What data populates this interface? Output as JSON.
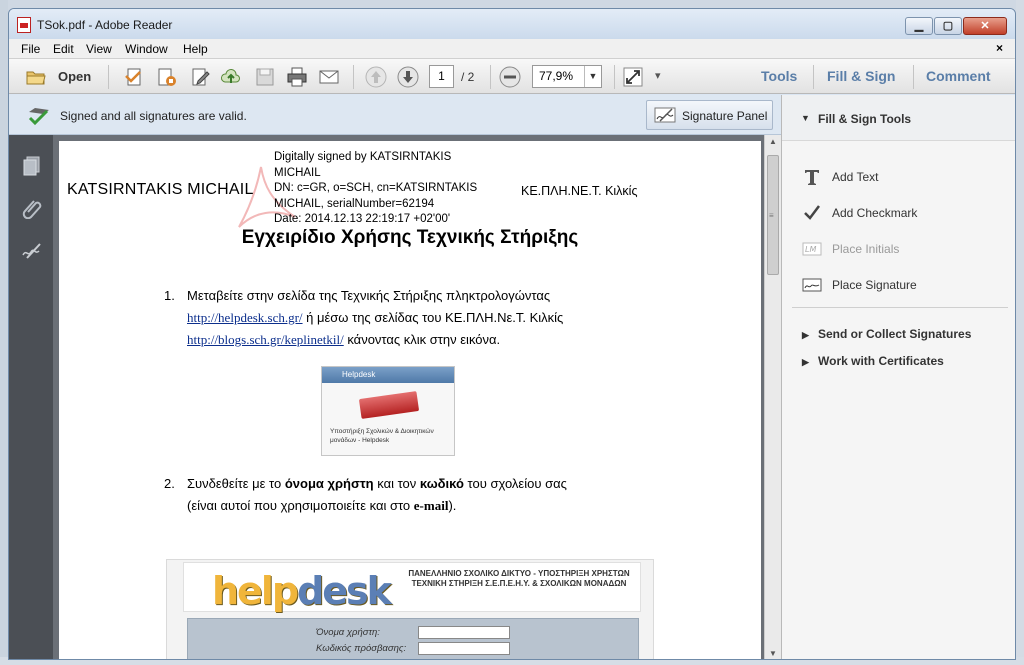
{
  "window": {
    "title": "TSok.pdf - Adobe Reader",
    "controls": {
      "minimize": "▁",
      "maximize": "▢",
      "close": "✕"
    }
  },
  "menu": {
    "items": [
      "File",
      "Edit",
      "View",
      "Window",
      "Help"
    ],
    "close_doc": "×"
  },
  "toolbar": {
    "open_label": "Open",
    "page_current": "1",
    "page_total": "/ 2",
    "zoom": "77,9%",
    "zoom_dd": "▼",
    "more": "▾",
    "tabs": [
      "Tools",
      "Fill & Sign",
      "Comment"
    ]
  },
  "signature_bar": {
    "status_text": "Signed and all signatures are valid.",
    "panel_button": "Signature Panel"
  },
  "document": {
    "author_name": "KATSIRNTAKIS MICHAIL",
    "signature_block": [
      "Digitally signed by KATSIRNTAKIS",
      "MICHAIL",
      "DN: c=GR, o=SCH, cn=KATSIRNTAKIS",
      "MICHAIL, serialNumber=62194",
      "Date: 2014.12.13 22:19:17 +02'00'"
    ],
    "organization": "ΚΕ.ΠΛΗ.ΝΕ.Τ. Κιλκίς",
    "title": "Εγχειρίδιο Χρήσης Τεχνικής Στήριξης",
    "item1": {
      "number": "1.",
      "line1": "Μεταβείτε στην σελίδα της Τεχνικής Στήριξης πληκτρολογώντας",
      "link1": "http://helpdesk.sch.gr/",
      "line2": " ή μέσω της σελίδας του ΚΕ.ΠΛΗ.Νε.Τ. Κιλκίς",
      "link2": "http://blogs.sch.gr/keplinetkil/",
      "line3": " κάνοντας κλικ στην εικόνα."
    },
    "thumb": {
      "header": "Helpdesk",
      "caption": "Υποστήριξη Σχολικών & Διοικητικών μονάδων - Helpdesk"
    },
    "item2": {
      "number": "2.",
      "pre": "Συνδεθείτε με το ",
      "bold1": "όνομα χρήστη",
      "mid": " και τον ",
      "bold2": "κωδικό",
      "post": " του σχολείου σας",
      "line2_pre": "(είναι αυτοί που χρησιμοποιείτε και στο ",
      "line2_bold": "e-mail",
      "line2_post": ")."
    },
    "screenshot": {
      "logo_a": "help",
      "logo_b": "desk",
      "head_line1": "ΠΑΝΕΛΛΗΝΙΟ ΣΧΟΛΙΚΟ ΔΙΚΤΥΟ - ΥΠΟΣΤΗΡΙΞΗ ΧΡΗΣΤΩΝ",
      "head_line2": "ΤΕΧΝΙΚΗ ΣΤΗΡΙΞΗ Σ.Ε.Π.Ε.Η.Υ. & ΣΧΟΛΙΚΩΝ ΜΟΝΑΔΩΝ",
      "field1": "Όνομα χρήστη:",
      "field2": "Κωδικός πρόσβασης:"
    }
  },
  "right_panel": {
    "section_title": "Fill & Sign Tools",
    "tools": [
      {
        "icon": "text-T-icon",
        "label": "Add Text",
        "enabled": true
      },
      {
        "icon": "checkmark-icon",
        "label": "Add Checkmark",
        "enabled": true
      },
      {
        "icon": "initials-icon",
        "label": "Place Initials",
        "enabled": false
      },
      {
        "icon": "signature-icon",
        "label": "Place Signature",
        "enabled": true
      }
    ],
    "collapsed_sections": [
      "Send or Collect Signatures",
      "Work with Certificates"
    ],
    "arrow_open": "▼",
    "arrow_closed": "▶"
  },
  "colors": {
    "tab_blue": "#5a7ea8",
    "rail_dark": "#4b4f55",
    "doc_bg": "#6b7077",
    "sigbar_bg": "#dde7f2"
  }
}
